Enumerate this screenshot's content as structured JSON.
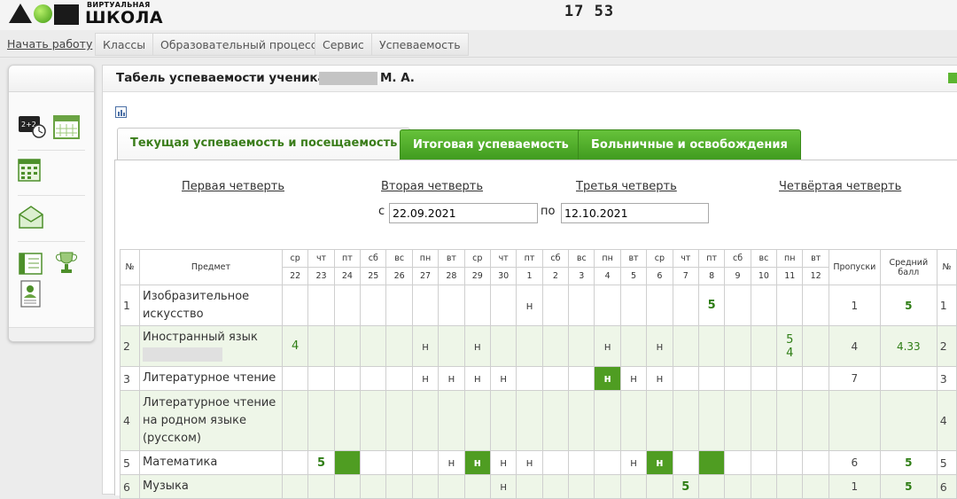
{
  "header": {
    "logo_small": "ВИРТУАЛЬНАЯ",
    "logo_big": "ШКОЛА",
    "clock": "17 53"
  },
  "menu": [
    "Начать работу",
    "Классы",
    "Образовательный процесс",
    "Сервис",
    "Успеваемость"
  ],
  "sidebar": {
    "icons": [
      "schedule-clock-icon",
      "calendar-icon",
      "calendar-grid-icon",
      "envelope-icon",
      "journal-book-icon",
      "trophy-icon",
      "student-card-icon"
    ]
  },
  "page": {
    "title": "Табель успеваемости ученика",
    "title_suffix": "М. А.",
    "tabs": [
      "Текущая успеваемость и посещаемость",
      "Итоговая успеваемость",
      "Больничные и освобождения"
    ],
    "quarters": [
      "Первая четверть",
      "Вторая четверть",
      "Третья четверть",
      "Четвёртая четверть"
    ],
    "from_label": "с",
    "to_label": "по",
    "date_from": "22.09.2021",
    "date_to": "12.10.2021"
  },
  "table": {
    "col_num": "№",
    "col_subject": "Предмет",
    "col_absences": "Пропуски",
    "col_avg": "Средний балл",
    "col_num_right": "№",
    "weekdays": [
      "ср",
      "чт",
      "пт",
      "сб",
      "вс",
      "пн",
      "вт",
      "ср",
      "чт",
      "пт",
      "сб",
      "вс",
      "пн",
      "вт",
      "ср",
      "чт",
      "пт",
      "сб",
      "вс",
      "пн",
      "вт"
    ],
    "days": [
      "22",
      "23",
      "24",
      "25",
      "26",
      "27",
      "28",
      "29",
      "30",
      "1",
      "2",
      "3",
      "4",
      "5",
      "6",
      "7",
      "8",
      "9",
      "10",
      "11",
      "12"
    ],
    "rows": [
      {
        "num": "1",
        "subject": "Изобразительное искусство",
        "hidden_name": false,
        "alt": false,
        "cells": [
          "",
          "",
          "",
          "",
          "",
          "",
          "",
          "",
          "",
          "н",
          "",
          "",
          "",
          "",
          "",
          "",
          "5",
          "",
          "",
          "",
          ""
        ],
        "fill": [],
        "absences": "1",
        "avg": "5",
        "num_right": "1"
      },
      {
        "num": "2",
        "subject": "Иностранный язык",
        "hidden_name": true,
        "alt": true,
        "cells": [
          "4",
          "",
          "",
          "",
          "",
          "н",
          "",
          "н",
          "",
          "",
          "",
          "",
          "н",
          "",
          "н",
          "",
          "",
          "",
          "",
          "5\n4",
          ""
        ],
        "fill": [],
        "absences": "4",
        "avg": "4.33",
        "num_right": "2"
      },
      {
        "num": "3",
        "subject": "Литературное чтение",
        "hidden_name": false,
        "alt": false,
        "cells": [
          "",
          "",
          "",
          "",
          "",
          "н",
          "н",
          "н",
          "н",
          "",
          "",
          "",
          "н",
          "н",
          "н",
          "",
          "",
          "",
          "",
          "",
          ""
        ],
        "fill": [
          12
        ],
        "absences": "7",
        "avg": "",
        "num_right": "3"
      },
      {
        "num": "4",
        "subject": "Литературное чтение на родном языке (русском)",
        "hidden_name": false,
        "alt": true,
        "cells": [
          "",
          "",
          "",
          "",
          "",
          "",
          "",
          "",
          "",
          "",
          "",
          "",
          "",
          "",
          "",
          "",
          "",
          "",
          "",
          "",
          ""
        ],
        "fill": [],
        "absences": "",
        "avg": "",
        "num_right": "4"
      },
      {
        "num": "5",
        "subject": "Математика",
        "hidden_name": false,
        "alt": false,
        "cells": [
          "",
          "5",
          "",
          "",
          "",
          "",
          "н",
          "н",
          "н",
          "н",
          "",
          "",
          "",
          "н",
          "н",
          "",
          "",
          "",
          "",
          "",
          ""
        ],
        "fill": [
          2,
          7,
          14,
          16
        ],
        "absences": "6",
        "avg": "5",
        "num_right": "5"
      },
      {
        "num": "6",
        "subject": "Музыка",
        "hidden_name": false,
        "alt": true,
        "cells": [
          "",
          "",
          "",
          "",
          "",
          "",
          "",
          "",
          "н",
          "",
          "",
          "",
          "",
          "",
          "",
          "5",
          "",
          "",
          "",
          "",
          ""
        ],
        "fill": [],
        "absences": "1",
        "avg": "5",
        "num_right": "6"
      }
    ]
  }
}
